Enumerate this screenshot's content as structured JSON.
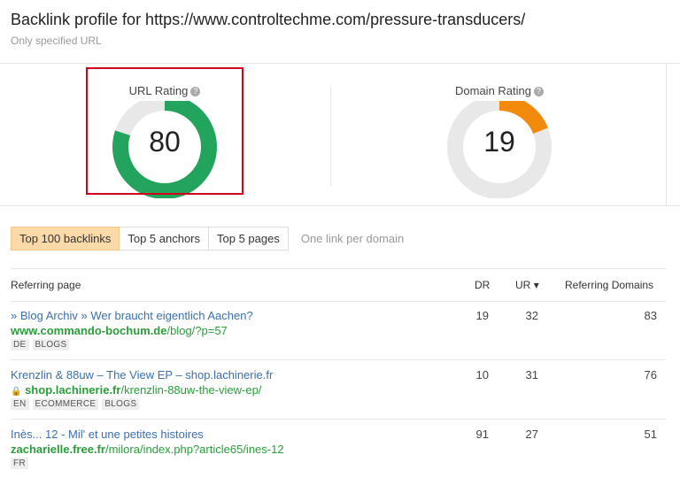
{
  "header": {
    "title": "Backlink profile for https://www.controltechme.com/pressure-transducers/",
    "subtitle": "Only specified URL"
  },
  "ratings": [
    {
      "label": "URL Rating",
      "value": 80,
      "color": "#22a45d"
    },
    {
      "label": "Domain Rating",
      "value": 19,
      "color": "#f28b0c"
    }
  ],
  "help_icon": "?",
  "tabs": [
    "Top 100 backlinks",
    "Top 5 anchors",
    "Top 5 pages"
  ],
  "option": "One link per domain",
  "columns": {
    "page": "Referring page",
    "dr": "DR",
    "ur": "UR",
    "ur_sort": "▾",
    "rd": "Referring Domains"
  },
  "rows": [
    {
      "title": "» Blog Archiv » Wer braucht eigentlich Aachen?",
      "domain": "www.commando-bochum.de",
      "path": "/blog/?p=57",
      "secure": false,
      "tags": [
        "DE",
        "BLOGS"
      ],
      "dr": "19",
      "ur": "32",
      "rd": "83"
    },
    {
      "title": "Krenzlin & 88uw – The View EP – shop.lachinerie.fr",
      "domain": "shop.lachinerie.fr",
      "path": "/krenzlin-88uw-the-view-ep/",
      "secure": true,
      "tags": [
        "EN",
        "ECOMMERCE",
        "BLOGS"
      ],
      "dr": "10",
      "ur": "31",
      "rd": "76"
    },
    {
      "title": "Inès... 12 - Mil' et une petites histoires",
      "domain": "zacharielle.free.fr",
      "path": "/milora/index.php?article65/ines-12",
      "secure": false,
      "tags": [
        "FR"
      ],
      "dr": "91",
      "ur": "27",
      "rd": "51"
    }
  ]
}
